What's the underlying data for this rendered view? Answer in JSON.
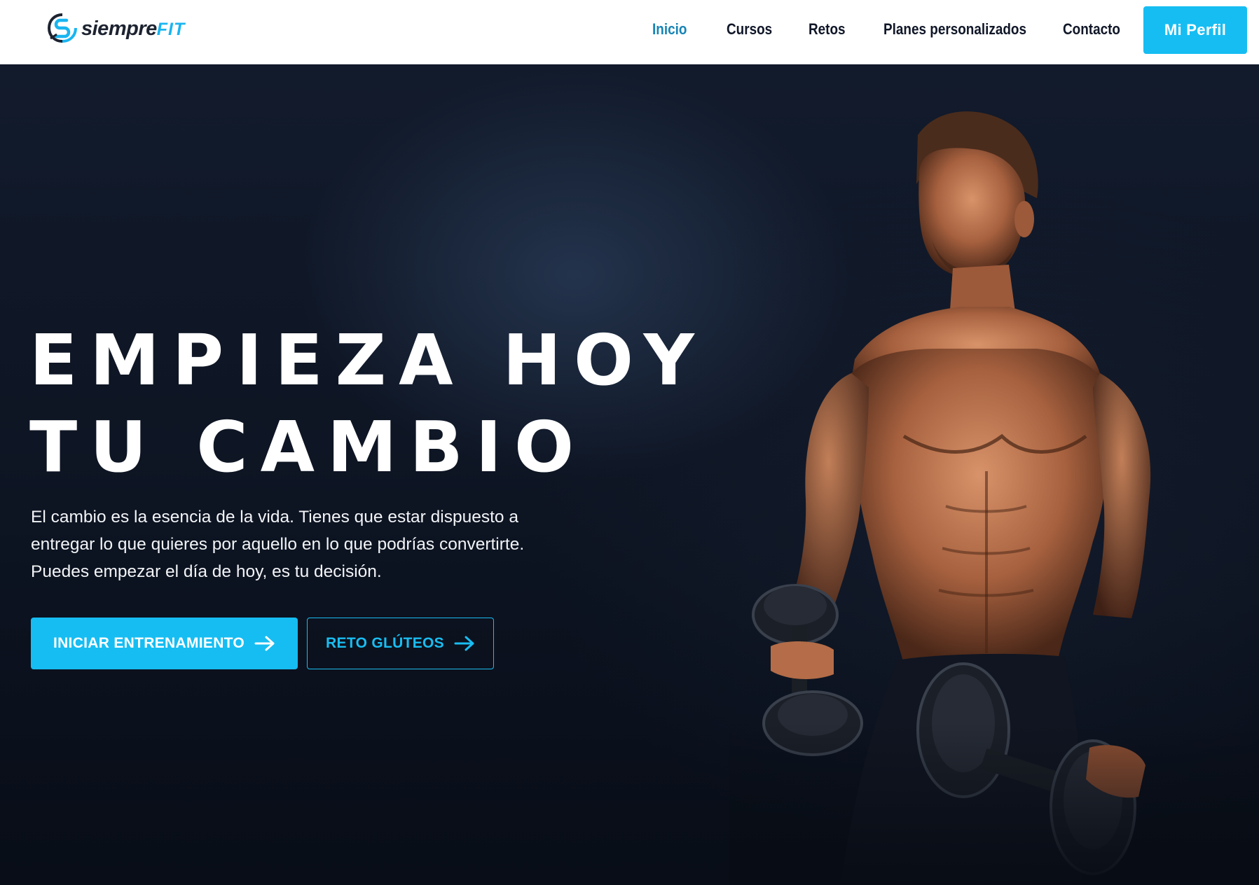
{
  "brand": {
    "name_part1": "siempre",
    "name_part2": "FIT"
  },
  "nav": {
    "items": [
      {
        "label": "Inicio",
        "active": true
      },
      {
        "label": "Cursos",
        "active": false
      },
      {
        "label": "Retos",
        "active": false
      },
      {
        "label": "Planes personalizados",
        "active": false
      },
      {
        "label": "Contacto",
        "active": false
      }
    ],
    "profile_button": "Mi Perfil"
  },
  "hero": {
    "headline_line1": "EMPIEZA HOY",
    "headline_line2": "TU CAMBIO",
    "lead": "El cambio es la esencia de la vida. Tienes que estar dispuesto a entregar lo que quieres por aquello en lo que podrías convertirte. Puedes empezar el día de hoy, es tu decisión.",
    "primary_button": "INICIAR ENTRENAMIENTO",
    "secondary_button": "RETO GLÚTEOS",
    "image": "muscular man holding dumbbells"
  },
  "colors": {
    "accent": "#16bdf2",
    "nav_active": "#1784b6",
    "nav_text": "#101728",
    "hero_bg": "#0e1524"
  }
}
